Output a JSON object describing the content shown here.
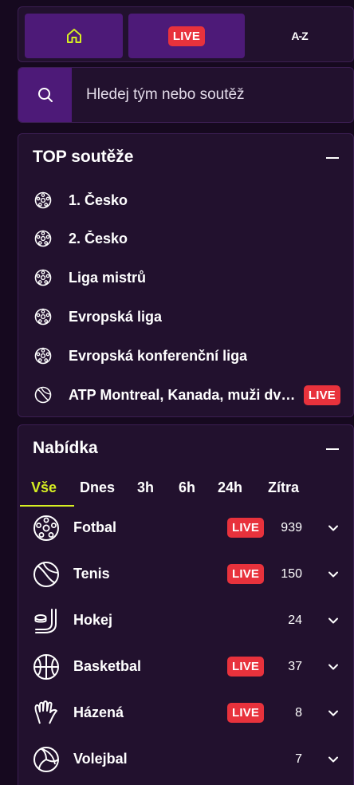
{
  "nav": {
    "live_label": "LIVE",
    "az_label": "A-Z"
  },
  "search": {
    "placeholder": "Hledej tým nebo soutěž"
  },
  "top": {
    "title": "TOP soutěže",
    "items": [
      {
        "label": "1. Česko",
        "icon": "soccer-ball-icon"
      },
      {
        "label": "2. Česko",
        "icon": "soccer-ball-icon"
      },
      {
        "label": "Liga mistrů",
        "icon": "soccer-ball-icon"
      },
      {
        "label": "Evropská liga",
        "icon": "soccer-ball-icon"
      },
      {
        "label": "Evropská konferenční liga",
        "icon": "soccer-ball-icon"
      },
      {
        "label": "ATP Montreal, Kanada, muži dvouhra",
        "icon": "tennis-ball-icon",
        "live": "LIVE"
      }
    ]
  },
  "offer": {
    "title": "Nabídka",
    "tabs": [
      "Vše",
      "Dnes",
      "3h",
      "6h",
      "24h",
      "Zítra"
    ],
    "sports": [
      {
        "label": "Fotbal",
        "live": "LIVE",
        "count": "939",
        "icon": "soccer-ball-icon"
      },
      {
        "label": "Tenis",
        "live": "LIVE",
        "count": "150",
        "icon": "tennis-ball-icon"
      },
      {
        "label": "Hokej",
        "live": "",
        "count": "24",
        "icon": "hockey-stick-icon"
      },
      {
        "label": "Basketbal",
        "live": "LIVE",
        "count": "37",
        "icon": "basketball-icon"
      },
      {
        "label": "Házená",
        "live": "LIVE",
        "count": "8",
        "icon": "handball-icon"
      },
      {
        "label": "Volejbal",
        "live": "",
        "count": "7",
        "icon": "volleyball-icon"
      }
    ]
  },
  "colors": {
    "background": "#16091f",
    "panel": "#22112e",
    "accent_purple": "#4d1a78",
    "live_red": "#e8323c",
    "active_tab": "#d7ef22"
  }
}
